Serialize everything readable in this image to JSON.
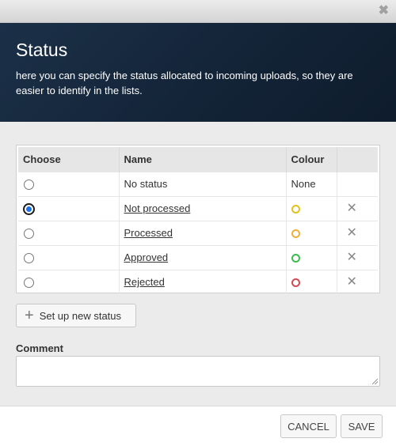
{
  "dialog": {
    "title": "Status",
    "description": "here you can specify the status allocated to incoming uploads, so they are easier to identify in the lists."
  },
  "table": {
    "headers": {
      "choose": "Choose",
      "name": "Name",
      "colour": "Colour"
    },
    "rows": [
      {
        "name": "No status",
        "colour_text": "None",
        "selected": false
      },
      {
        "name": "Not processed",
        "colour": "#e0c21c",
        "selected": true
      },
      {
        "name": "Processed",
        "colour": "#efb03a",
        "selected": false
      },
      {
        "name": "Approved",
        "colour": "#3dbb4f",
        "selected": false
      },
      {
        "name": "Rejected",
        "colour": "#d24b53",
        "selected": false
      }
    ]
  },
  "actions": {
    "new_status_label": "Set up new status",
    "comment_label": "Comment",
    "comment_value": "",
    "cancel_label": "CANCEL",
    "save_label": "SAVE"
  },
  "icons": {
    "close": "close-icon",
    "plus": "plus-icon",
    "delete": "delete-icon"
  }
}
